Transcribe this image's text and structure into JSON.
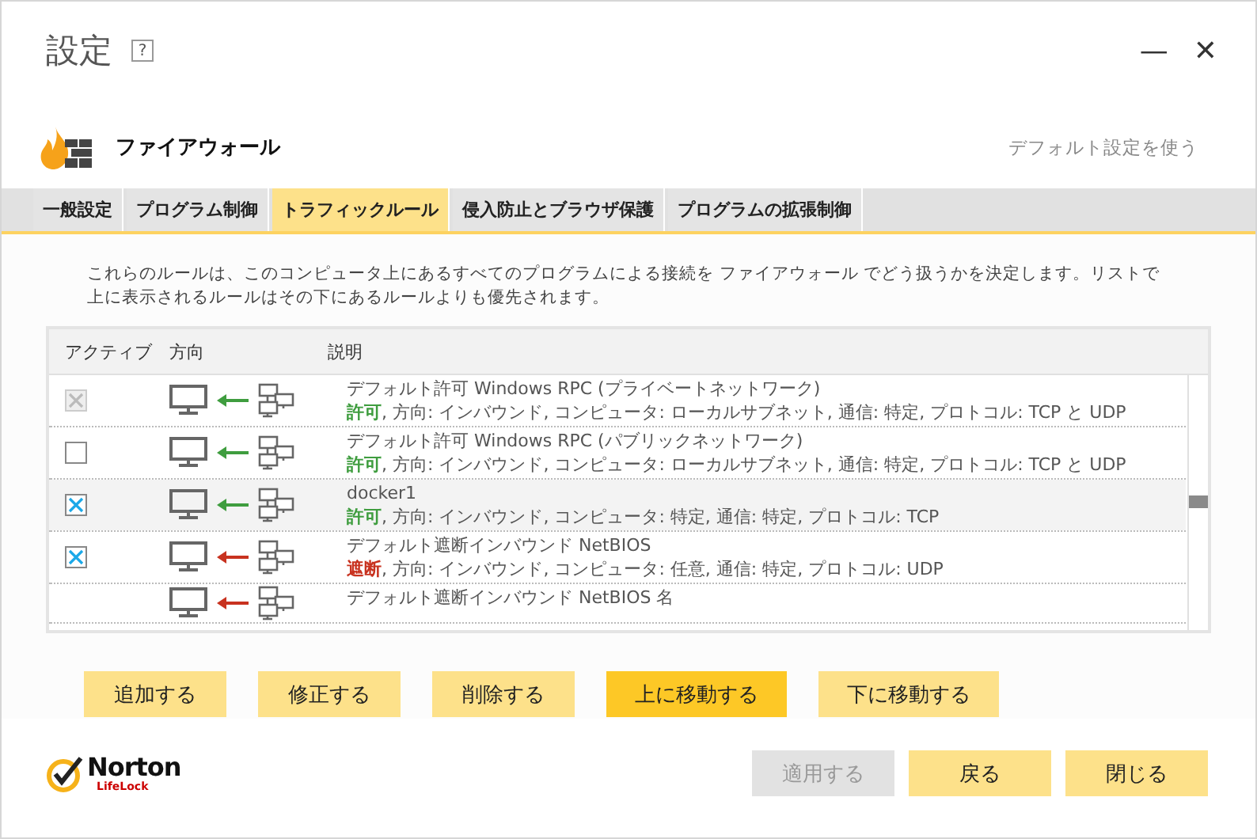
{
  "window": {
    "title": "設定",
    "help": "?",
    "minimize": "—",
    "close": "✕"
  },
  "section": {
    "title": "ファイアウォール",
    "default_link": "デフォルト設定を使う"
  },
  "tabs": [
    {
      "label": "一般設定",
      "selected": false
    },
    {
      "label": "プログラム制御",
      "selected": false
    },
    {
      "label": "トラフィックルール",
      "selected": true
    },
    {
      "label": "侵入防止とブラウザ保護",
      "selected": false
    },
    {
      "label": "プログラムの拡張制御",
      "selected": false
    }
  ],
  "intro": "これらのルールは、このコンピュータ上にあるすべてのプログラムによる接続を ファイアウォール でどう扱うかを決定します。リストで上に表示されるルールはその下にあるルールよりも優先されます。",
  "table": {
    "columns": [
      "アクティブ",
      "方向",
      "説明"
    ],
    "rows": [
      {
        "kind": "allow",
        "checked": true,
        "disabled": true,
        "selected": false,
        "title": "デフォルト許可 Windows RPC (プライベートネットワーク)",
        "action": "許可",
        "details": ", 方向: インバウンド, コンピュータ: ローカルサブネット, 通信: 特定, プロトコル: TCP と UDP"
      },
      {
        "kind": "allow",
        "checked": false,
        "disabled": false,
        "selected": false,
        "title": "デフォルト許可 Windows RPC (パブリックネットワーク)",
        "action": "許可",
        "details": ", 方向: インバウンド, コンピュータ: ローカルサブネット, 通信: 特定, プロトコル: TCP と UDP"
      },
      {
        "kind": "allow",
        "checked": true,
        "disabled": false,
        "selected": true,
        "title": "docker1",
        "action": "許可",
        "details": ", 方向: インバウンド, コンピュータ: 特定, 通信: 特定, プロトコル: TCP"
      },
      {
        "kind": "block",
        "checked": true,
        "disabled": false,
        "selected": false,
        "title": "デフォルト遮断インバウンド NetBIOS",
        "action": "遮断",
        "details": ", 方向: インバウンド, コンピュータ: 任意, 通信: 特定, プロトコル: UDP"
      },
      {
        "kind": "block",
        "title": "デフォルト遮断インバウンド NetBIOS 名"
      }
    ]
  },
  "actions": [
    {
      "label": "追加する",
      "highlighted": false
    },
    {
      "label": "修正する",
      "highlighted": false
    },
    {
      "label": "削除する",
      "highlighted": false
    },
    {
      "label": "上に移動する",
      "highlighted": true
    },
    {
      "label": "下に移動する",
      "highlighted": false
    }
  ],
  "footer": {
    "logo_name": "Norton",
    "logo_sub": "LifeLock",
    "buttons": [
      {
        "label": "適用する",
        "disabled": true
      },
      {
        "label": "戻る",
        "disabled": false
      },
      {
        "label": "閉じる",
        "disabled": false
      }
    ]
  }
}
